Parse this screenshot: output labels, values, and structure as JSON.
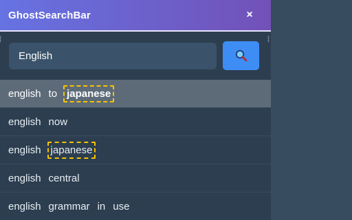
{
  "app": {
    "title": "GhostSearchBar",
    "close_label": "×"
  },
  "search": {
    "value": "English",
    "button_icon": "search-icon"
  },
  "suggestions": [
    {
      "words": [
        "english",
        "to",
        "japanese"
      ],
      "highlight": [
        2
      ],
      "active": true
    },
    {
      "words": [
        "english",
        "now"
      ],
      "highlight": [],
      "active": false
    },
    {
      "words": [
        "english",
        "japanese"
      ],
      "highlight": [
        1
      ],
      "active": false
    },
    {
      "words": [
        "english",
        "central"
      ],
      "highlight": [],
      "active": false
    },
    {
      "words": [
        "english",
        "grammar",
        "in",
        "use"
      ],
      "highlight": [],
      "active": false
    }
  ],
  "colors": {
    "accent_gradient_start": "#6673e2",
    "accent_gradient_end": "#7251b8",
    "search_button": "#3d8df5",
    "highlight_border": "#f5c400"
  }
}
